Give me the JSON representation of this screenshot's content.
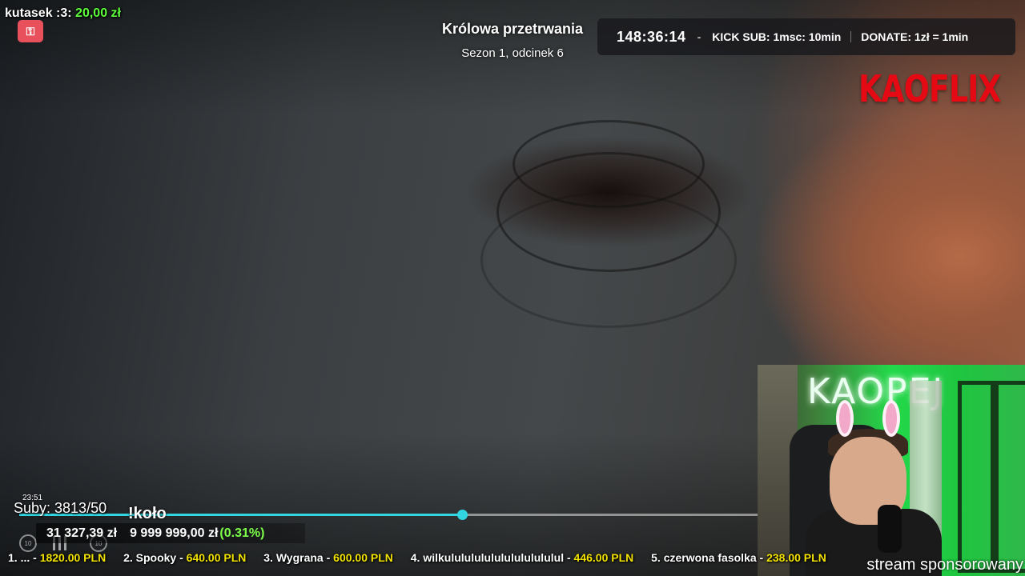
{
  "donation": {
    "name": "kutasek :3:",
    "amount": "20,00 zł",
    "icon": "key-icon"
  },
  "episode": {
    "title": "Królowa przetrwania",
    "subtitle": "Sezon 1, odcinek 6"
  },
  "subathon": {
    "timer": "148:36:14",
    "separator": "-",
    "kick_sub": "KICK SUB: 1msc: 10min",
    "donate": "DONATE: 1zł = 1min"
  },
  "logo": "KAOFLIX",
  "player": {
    "clock": "23:51",
    "progress": 0.6,
    "subs": "Suby: 3813/50",
    "command": "!koło"
  },
  "goal": {
    "current": "31 327,39 zł",
    "target": "9 999 999,00 zł",
    "percent": "(0.31%)"
  },
  "leaderboard": [
    {
      "rank": "1. ... - ",
      "value": "1820.00 PLN"
    },
    {
      "rank": "2. Spooky - ",
      "value": "640.00 PLN"
    },
    {
      "rank": "3. Wygrana - ",
      "value": "600.00 PLN"
    },
    {
      "rank": "4. wilkulululululululululululul - ",
      "value": "446.00 PLN"
    },
    {
      "rank": "5. czerwona fasolka - ",
      "value": "238.00 PLN"
    }
  ],
  "webcam": {
    "neon_sign": "KAOPEJ",
    "sponsor": "stream sponsorowany"
  },
  "colors": {
    "accent": "#31d6e0",
    "brand": "#e50914",
    "money": "#5cff3a",
    "ticker_value": "#f2e200"
  }
}
